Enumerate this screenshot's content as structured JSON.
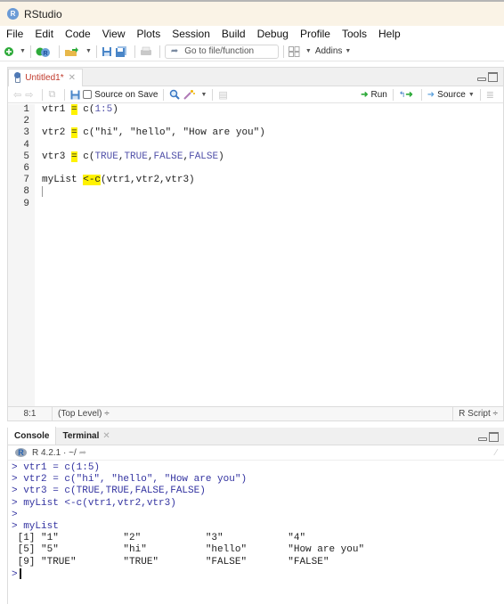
{
  "window": {
    "title": "RStudio",
    "logo_letter": "R"
  },
  "menu": [
    "File",
    "Edit",
    "Code",
    "View",
    "Plots",
    "Session",
    "Build",
    "Debug",
    "Profile",
    "Tools",
    "Help"
  ],
  "toolbar": {
    "goto_placeholder": "Go to file/function",
    "addins_label": "Addins"
  },
  "editor": {
    "tab_label": "Untitled1*",
    "source_on_save_label": "Source on Save",
    "source_on_save_checked": false,
    "run_label": "Run",
    "source_label": "Source",
    "line_numbers": [
      "1",
      "2",
      "3",
      "4",
      "5",
      "6",
      "7",
      "8",
      "9"
    ],
    "lines": [
      {
        "pre": "vtr1 ",
        "hl": "=",
        "post": " c(1:5)"
      },
      {
        "pre": "",
        "hl": "",
        "post": ""
      },
      {
        "pre": "vtr2 ",
        "hl": "=",
        "post": " c(\"hi\", \"hello\", \"How are you\")"
      },
      {
        "pre": "",
        "hl": "",
        "post": ""
      },
      {
        "pre": "vtr3 ",
        "hl": "=",
        "post": " c(TRUE,TRUE,FALSE,FALSE)"
      },
      {
        "pre": "",
        "hl": "",
        "post": ""
      },
      {
        "pre": "myList ",
        "hl": "<-c",
        "post": "(vtr1,vtr2,vtr3)"
      },
      {
        "pre": "",
        "hl": "",
        "post": ""
      },
      {
        "pre": "",
        "hl": "",
        "post": ""
      }
    ],
    "status": {
      "position": "8:1",
      "scope": "(Top Level) ÷",
      "file_type": "R Script ÷"
    }
  },
  "console": {
    "tabs": [
      {
        "label": "Console",
        "active": true
      },
      {
        "label": "Terminal",
        "active": false,
        "closable": true
      }
    ],
    "r_version": "R 4.2.1 · ~/",
    "lines": [
      {
        "type": "in",
        "text": "> vtr1 = c(1:5)"
      },
      {
        "type": "in",
        "text": "> vtr2 = c(\"hi\", \"hello\", \"How are you\")"
      },
      {
        "type": "in",
        "text": "> vtr3 = c(TRUE,TRUE,FALSE,FALSE)"
      },
      {
        "type": "in",
        "text": "> myList <-c(vtr1,vtr2,vtr3)"
      },
      {
        "type": "in",
        "text": ">"
      },
      {
        "type": "in",
        "text": "> myList"
      },
      {
        "type": "out",
        "text": " [1] \"1\"           \"2\"           \"3\"           \"4\""
      },
      {
        "type": "out",
        "text": " [5] \"5\"           \"hi\"          \"hello\"       \"How are you\""
      },
      {
        "type": "out",
        "text": " [9] \"TRUE\"        \"TRUE\"        \"FALSE\"       \"FALSE\""
      }
    ],
    "prompt": ">"
  }
}
